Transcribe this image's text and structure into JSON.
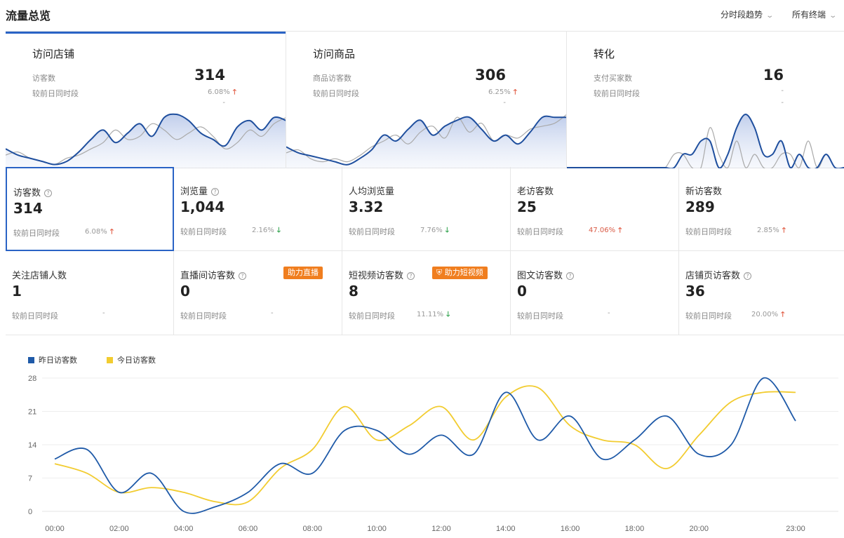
{
  "header": {
    "title": "流量总览",
    "dropdown_trend": "分时段趋势",
    "dropdown_terminal": "所有终端"
  },
  "funnel": [
    {
      "title": "访问店铺",
      "metric": "访客数",
      "value": "314",
      "compare": "较前日同时段",
      "pct": "6.08%",
      "dir": "up",
      "extra": "-"
    },
    {
      "title": "访问商品",
      "metric": "商品访客数",
      "value": "306",
      "compare": "较前日同时段",
      "pct": "6.25%",
      "dir": "up",
      "extra": "-"
    },
    {
      "title": "转化",
      "metric": "支付买家数",
      "value": "16",
      "compare": "较前日同时段",
      "pct": "-",
      "dir": "",
      "extra": "-"
    }
  ],
  "metrics": [
    {
      "label": "访客数",
      "value": "314",
      "compare": "较前日同时段",
      "pct": "6.08%",
      "dir": "up",
      "help": true
    },
    {
      "label": "浏览量",
      "value": "1,044",
      "compare": "较前日同时段",
      "pct": "2.16%",
      "dir": "down",
      "help": true
    },
    {
      "label": "人均浏览量",
      "value": "3.32",
      "compare": "较前日同时段",
      "pct": "7.76%",
      "dir": "down",
      "help": false
    },
    {
      "label": "老访客数",
      "value": "25",
      "compare": "较前日同时段",
      "pct": "47.06%",
      "dir": "up",
      "help": false
    },
    {
      "label": "新访客数",
      "value": "289",
      "compare": "较前日同时段",
      "pct": "2.85%",
      "dir": "up",
      "help": false
    },
    {
      "label": "关注店铺人数",
      "value": "1",
      "compare": "较前日同时段",
      "pct": "-",
      "dir": "",
      "help": false
    },
    {
      "label": "直播间访客数",
      "value": "0",
      "compare": "较前日同时段",
      "pct": "-",
      "dir": "",
      "help": true
    },
    {
      "label": "短视频访客数",
      "value": "8",
      "compare": "较前日同时段",
      "pct": "11.11%",
      "dir": "down",
      "help": true
    },
    {
      "label": "图文访客数",
      "value": "0",
      "compare": "较前日同时段",
      "pct": "-",
      "dir": "",
      "help": true
    },
    {
      "label": "店铺页访客数",
      "value": "36",
      "compare": "较前日同时段",
      "pct": "20.00%",
      "dir": "up",
      "help": true
    }
  ],
  "badges": {
    "live": "助力直播",
    "video": "助力短视频"
  },
  "chart_data": {
    "type": "line",
    "title": "",
    "xlabel": "",
    "ylabel": "",
    "x": [
      "00:00",
      "01:00",
      "02:00",
      "03:00",
      "04:00",
      "05:00",
      "06:00",
      "07:00",
      "08:00",
      "09:00",
      "10:00",
      "11:00",
      "12:00",
      "13:00",
      "14:00",
      "15:00",
      "16:00",
      "17:00",
      "18:00",
      "19:00",
      "20:00",
      "21:00",
      "22:00",
      "23:00"
    ],
    "x_tick_labels": [
      "00:00",
      "02:00",
      "04:00",
      "06:00",
      "08:00",
      "10:00",
      "12:00",
      "14:00",
      "16:00",
      "18:00",
      "20:00",
      "23:00"
    ],
    "y_ticks": [
      0,
      7,
      14,
      21,
      28
    ],
    "ylim": [
      0,
      28
    ],
    "legend_position": "top-left",
    "grid": true,
    "series": [
      {
        "name": "昨日访客数",
        "color": "#1f5aa8",
        "values": [
          11,
          13,
          4,
          8,
          0,
          1,
          4,
          10,
          8,
          17,
          17,
          12,
          16,
          12,
          25,
          15,
          20,
          11,
          15,
          20,
          12,
          14,
          28,
          19
        ]
      },
      {
        "name": "今日访客数",
        "color": "#f2cc30",
        "values": [
          10,
          8,
          4,
          5,
          4,
          2,
          2,
          9,
          13,
          22,
          15,
          18,
          22,
          15,
          24,
          26,
          18,
          15,
          14,
          9,
          16,
          23,
          25,
          25
        ]
      }
    ]
  },
  "mini_charts": [
    {
      "today": [
        6,
        4,
        3,
        2,
        1,
        2,
        5,
        9,
        12,
        8,
        11,
        14,
        10,
        16,
        17,
        15,
        11,
        9,
        7,
        13,
        15,
        12,
        16,
        15
      ],
      "yesterday": [
        4,
        5,
        3,
        2,
        1,
        3,
        4,
        6,
        8,
        12,
        9,
        10,
        14,
        12,
        9,
        11,
        13,
        10,
        6,
        8,
        12,
        10,
        14,
        16
      ]
    },
    {
      "today": [
        7,
        5,
        4,
        3,
        2,
        1,
        3,
        6,
        11,
        9,
        13,
        16,
        11,
        14,
        16,
        17,
        13,
        9,
        11,
        8,
        12,
        17,
        17,
        17
      ],
      "yesterday": [
        5,
        6,
        3,
        2,
        3,
        2,
        4,
        7,
        9,
        11,
        8,
        12,
        14,
        10,
        17,
        12,
        15,
        9,
        11,
        10,
        13,
        14,
        15,
        18
      ]
    },
    {
      "today": [
        0,
        0,
        0,
        0,
        0,
        0,
        0,
        0,
        0,
        0,
        0,
        0,
        0,
        1,
        1,
        2,
        2,
        0,
        1,
        3,
        4,
        3,
        1,
        1,
        2,
        0,
        1,
        0,
        0,
        1,
        0,
        0
      ],
      "yesterday": [
        0,
        0,
        0,
        0,
        0,
        0,
        0,
        0,
        0,
        0,
        0,
        0,
        1,
        1,
        0,
        0,
        3,
        1,
        0,
        2,
        0,
        1,
        0,
        0,
        1,
        1,
        0,
        2,
        0,
        1,
        0,
        0
      ]
    }
  ]
}
